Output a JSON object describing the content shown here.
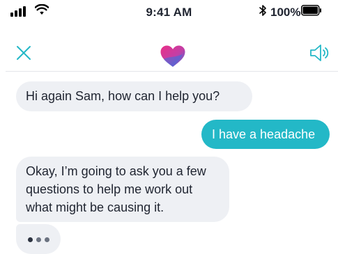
{
  "status": {
    "time": "9:41 AM",
    "battery_percent": "100%",
    "battery_level": 1.0
  },
  "header": {
    "close_icon": "close-icon",
    "logo_icon": "heart-logo",
    "sound_icon": "speaker-icon"
  },
  "messages": [
    {
      "sender": "bot",
      "text": "Hi again Sam, how can I help you?"
    },
    {
      "sender": "user",
      "text": "I have a headache"
    },
    {
      "sender": "bot",
      "text": "Okay, I’m going to ask you a few questions to help me work out what might be causing it."
    }
  ],
  "typing_indicator": {
    "visible": true,
    "dots": 3
  },
  "colors": {
    "accent": "#23b8c7",
    "bot_bubble": "#eef0f4",
    "text": "#1f2430",
    "logo_pink": "#ea2f87",
    "logo_blue": "#3a6fe0"
  }
}
